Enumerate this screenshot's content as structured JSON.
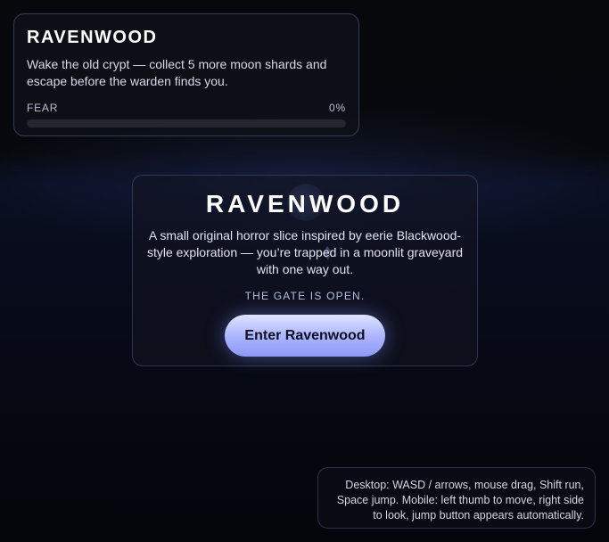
{
  "hud": {
    "title": "RAVENWOOD",
    "objective": "Wake the old crypt — collect 5 more moon shards and escape before the warden finds you.",
    "fear_label": "FEAR",
    "fear_value_text": "0%",
    "fear_fraction": 0
  },
  "start_panel": {
    "title": "RAVENWOOD",
    "description": "A small original horror slice inspired by eerie Blackwood-style exploration — you’re trapped in a moonlit graveyard with one way out.",
    "status": "THE GATE IS OPEN.",
    "enter_label": "Enter Ravenwood"
  },
  "controls_hint": {
    "text": "Desktop: WASD / arrows, mouse drag, Shift run, Space jump. Mobile: left thumb to move, right side to look, jump button appears automatically."
  },
  "colors": {
    "accent": "#a9b3ff",
    "background": "#060812"
  }
}
